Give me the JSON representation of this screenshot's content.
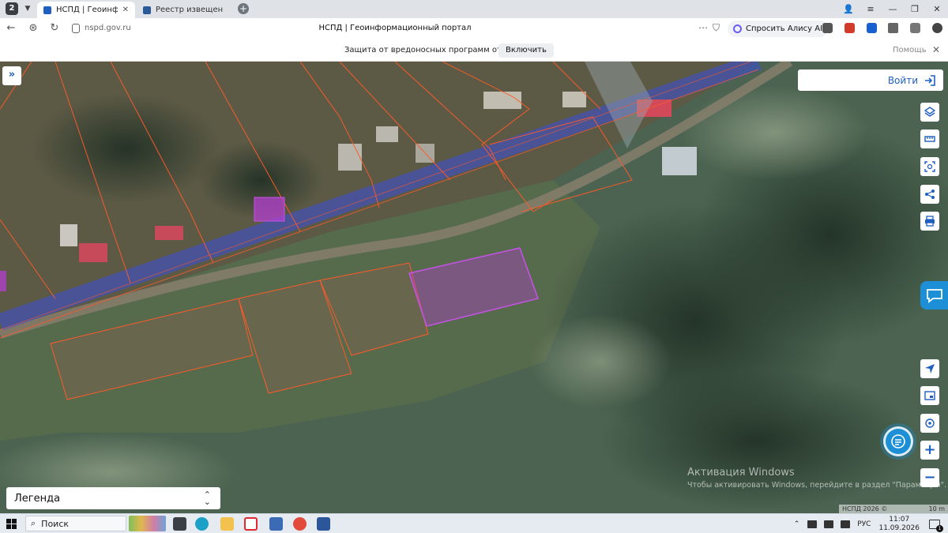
{
  "browser": {
    "tab_count": "2",
    "tabs": [
      {
        "label": "НСПД | Геоинформаци",
        "active": true
      },
      {
        "label": "Реестр извещений",
        "active": false
      }
    ],
    "url_host": "nspd.gov.ru",
    "page_title": "НСПД | Геоинформационный портал",
    "alice_label": "Спросить Алису AI"
  },
  "infobar": {
    "message": "Защита от вредоносных программ отключена",
    "enable_label": "Включить",
    "help_label": "Помощь"
  },
  "map": {
    "login_label": "Войти",
    "legend_label": "Легенда",
    "attribution": "НСПД 2026 ©",
    "scale_label": "10 m",
    "tools": [
      "layers-icon",
      "ruler-icon",
      "select-area-icon",
      "share-icon",
      "print-icon",
      "navigate-icon",
      "minimap-icon",
      "location-icon",
      "zoom-in",
      "zoom-out"
    ]
  },
  "watermark": {
    "title": "Активация Windows",
    "subtitle": "Чтобы активировать Windows, перейдите в раздел \"Параметры\"."
  },
  "taskbar": {
    "search_label": "Поиск",
    "lang": "РУС",
    "time": "11:07",
    "date": "11.09.2026",
    "notifications": "1"
  },
  "colors": {
    "accent": "#1f5fbf",
    "parcel_border": "#ff5a2a",
    "highlight_parcel": "#b43fd0",
    "road_zone": "#3a4fd8"
  }
}
